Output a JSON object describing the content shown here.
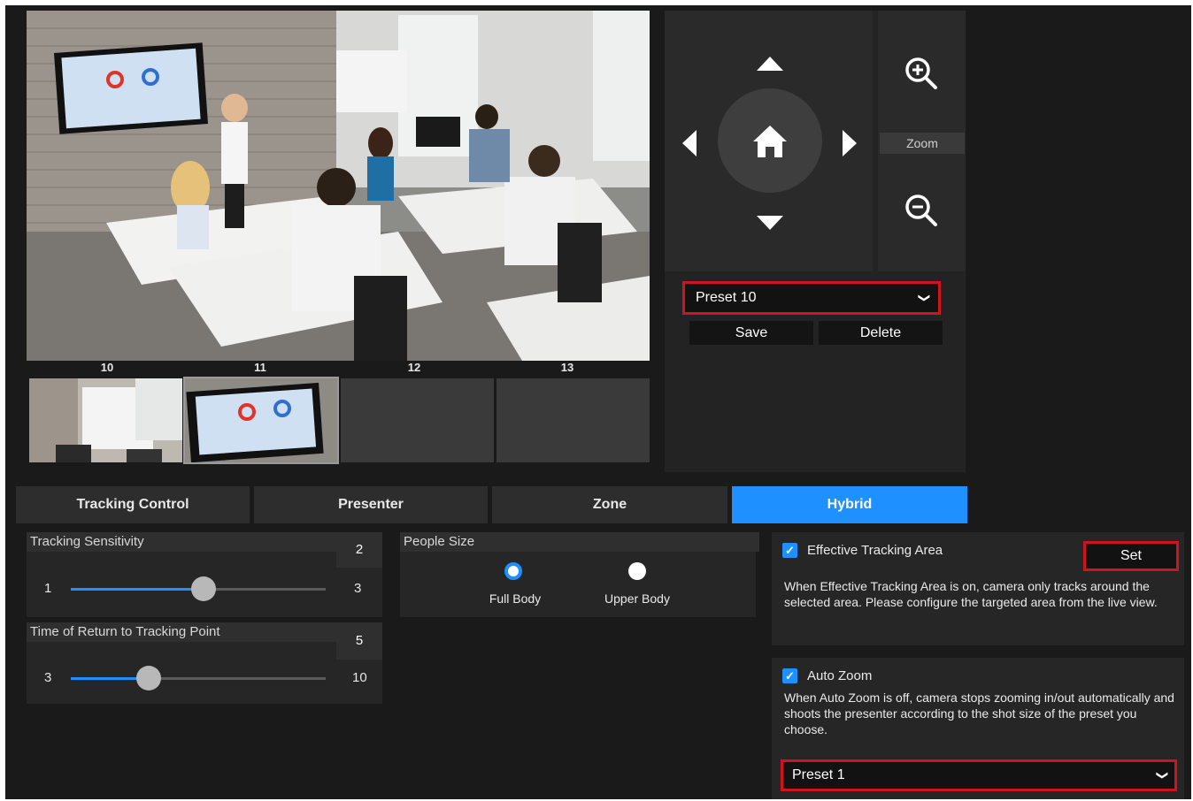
{
  "thumbnails": {
    "labels": [
      "10",
      "11",
      "12",
      "13"
    ],
    "selected_index": 1
  },
  "ptz": {
    "zoom_label": "Zoom",
    "preset_select": {
      "value": "Preset 10"
    },
    "save_label": "Save",
    "delete_label": "Delete",
    "icons": [
      "arrow-up-icon",
      "arrow-down-icon",
      "arrow-left-icon",
      "arrow-right-icon",
      "home-icon",
      "zoom-in-icon",
      "zoom-out-icon"
    ]
  },
  "tabs": [
    {
      "label": "Tracking Control",
      "active": false
    },
    {
      "label": "Presenter",
      "active": false
    },
    {
      "label": "Zone",
      "active": false
    },
    {
      "label": "Hybrid",
      "active": true
    }
  ],
  "tracking_sensitivity": {
    "title": "Tracking Sensitivity",
    "value": "2",
    "min": "1",
    "max": "3"
  },
  "return_time": {
    "title": "Time of Return to Tracking Point",
    "value": "5",
    "min": "3",
    "max": "10"
  },
  "people_size": {
    "title": "People Size",
    "options": [
      {
        "label": "Full Body",
        "selected": true
      },
      {
        "label": "Upper Body",
        "selected": false
      }
    ]
  },
  "effective_area": {
    "label": "Effective Tracking Area",
    "checked": true,
    "set_label": "Set",
    "description": "When Effective Tracking Area is on, camera only tracks around the selected area. Please configure the targeted area from the live view."
  },
  "auto_zoom": {
    "label": "Auto Zoom",
    "checked": true,
    "description": "When Auto Zoom is off, camera stops zooming in/out automatically and shoots the presenter according to the shot size of the preset you choose.",
    "preset_value": "Preset 1"
  },
  "colors": {
    "accent": "#1e90ff",
    "highlight": "#d1121f",
    "background": "#1a1a1a"
  }
}
